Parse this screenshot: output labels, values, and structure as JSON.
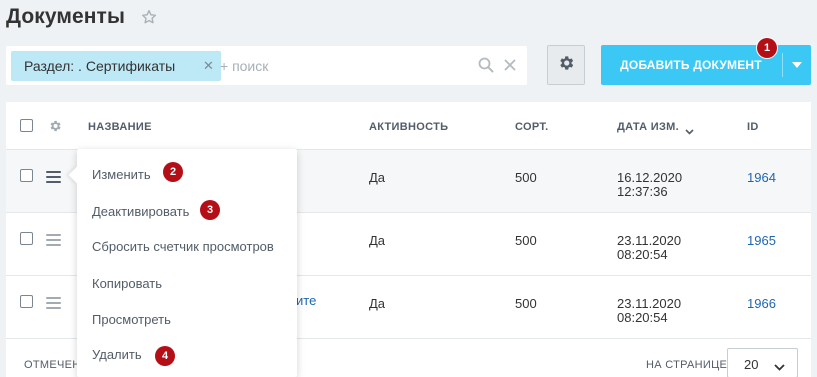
{
  "header": {
    "title": "Документы"
  },
  "filter": {
    "tag_label": "Раздел: . Сертификаты",
    "search_placeholder": "+ поиск"
  },
  "toolbar": {
    "add_label": "ДОБАВИТЬ ДОКУМЕНТ"
  },
  "table": {
    "columns": [
      "НАЗВАНИЕ",
      "АКТИВНОСТЬ",
      "СОРТ.",
      "ДАТА ИЗМ.",
      "ID"
    ],
    "rows": [
      {
        "active": "Да",
        "sort": "500",
        "date": "16.12.2020",
        "time": "12:37:36",
        "id": "1964"
      },
      {
        "active": "Да",
        "sort": "500",
        "date": "23.11.2020",
        "time": "08:20:54",
        "id": "1965"
      },
      {
        "active": "Да",
        "sort": "500",
        "date": "23.11.2020",
        "time": "08:20:54",
        "id": "1966"
      }
    ],
    "name_fragment": "ите"
  },
  "footer": {
    "selected_label": "ОТМЕЧЕН",
    "per_page_label": "НА СТРАНИЦЕ:",
    "per_page_value": "20"
  },
  "context_menu": {
    "items": [
      "Изменить",
      "Деактивировать",
      "Сбросить счетчик просмотров",
      "Копировать",
      "Просмотреть",
      "Удалить"
    ]
  },
  "badges": [
    "1",
    "2",
    "3",
    "4"
  ],
  "colors": {
    "accent": "#3bc8f5",
    "tag_bg": "#bde8f6",
    "badge": "#b40e17",
    "link": "#2067b0"
  }
}
